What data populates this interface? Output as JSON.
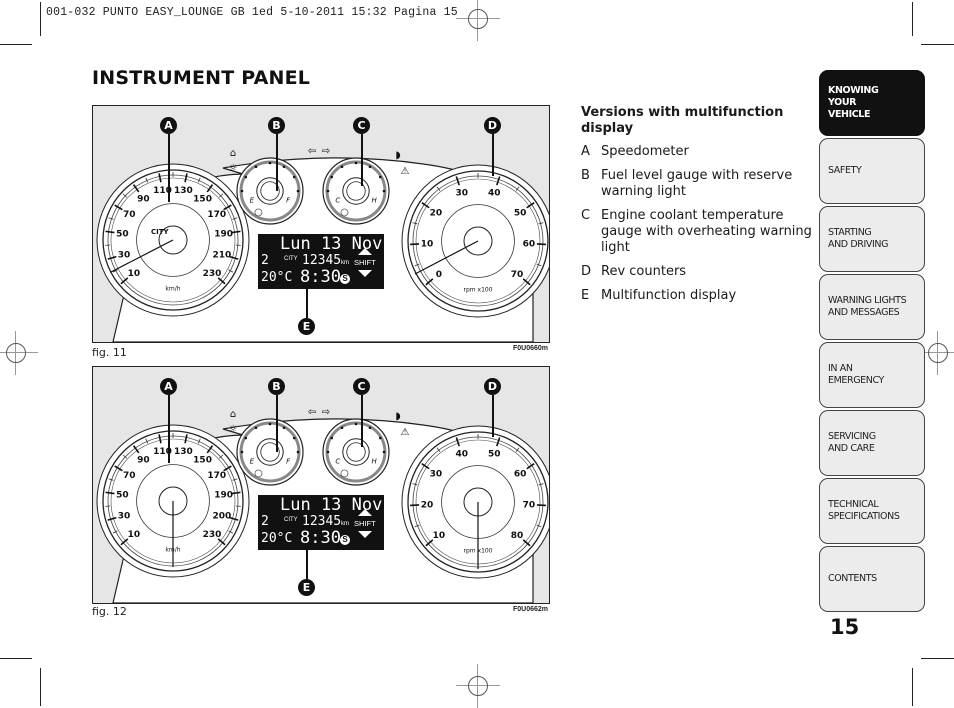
{
  "slug": "001-032 PUNTO EASY_LOUNGE GB 1ed  5-10-2011  15:32  Pagina 15",
  "page_title": "INSTRUMENT PANEL",
  "figures": [
    {
      "caption": "fig. 11",
      "code": "F0U0660m",
      "callouts": [
        "A",
        "B",
        "C",
        "D",
        "E"
      ],
      "speedo": {
        "ticks": [
          "10",
          "30",
          "50",
          "70",
          "90",
          "110",
          "130",
          "150",
          "170",
          "190",
          "210",
          "230"
        ],
        "unit": "km/h",
        "city": "CITY"
      },
      "fuel": {
        "empty": "E",
        "full": "F"
      },
      "temp": {
        "cold": "C",
        "hot": "H"
      },
      "rev": {
        "ticks": [
          "0",
          "10",
          "20",
          "30",
          "40",
          "50",
          "60",
          "70"
        ],
        "unit": "rpm x100"
      },
      "display": {
        "line1": "Lun 13 Nov",
        "gear": "2",
        "city": "CITY",
        "odometer": "12345",
        "odo_unit": "km",
        "temp": "20°C",
        "time": "8:30",
        "s_badge": "S",
        "shift": "SHIFT"
      }
    },
    {
      "caption": "fig. 12",
      "code": "F0U0662m",
      "callouts": [
        "A",
        "B",
        "C",
        "D",
        "E"
      ],
      "speedo": {
        "ticks": [
          "10",
          "30",
          "50",
          "70",
          "90",
          "110",
          "130",
          "150",
          "170",
          "190",
          "200",
          "230"
        ],
        "unit": "km/h"
      },
      "fuel": {
        "empty": "E",
        "full": "F"
      },
      "temp": {
        "cold": "C",
        "hot": "H"
      },
      "rev": {
        "ticks": [
          "10",
          "20",
          "30",
          "40",
          "50",
          "60",
          "70",
          "80"
        ],
        "unit": "rpm x100"
      },
      "display": {
        "line1": "Lun 13 Nov",
        "gear": "2",
        "city": "CITY",
        "odometer": "12345",
        "odo_unit": "km",
        "temp": "20°C",
        "time": "8:30",
        "s_badge": "S",
        "shift": "SHIFT"
      }
    }
  ],
  "legend": {
    "heading": "Versions with multifunction display",
    "items": [
      {
        "letter": "A",
        "text": "Speedometer"
      },
      {
        "letter": "B",
        "text": "Fuel level gauge with reserve warning light"
      },
      {
        "letter": "C",
        "text": "Engine coolant temperature gauge with overheating warning light"
      },
      {
        "letter": "D",
        "text": "Rev counters"
      },
      {
        "letter": "E",
        "text": "Multifunction display"
      }
    ]
  },
  "tabs": [
    {
      "line1": "KNOWING",
      "line2": "YOUR",
      "line3": "VEHICLE",
      "active": true
    },
    {
      "line1": "SAFETY",
      "line2": "",
      "line3": ""
    },
    {
      "line1": "STARTING",
      "line2": "AND DRIVING",
      "line3": ""
    },
    {
      "line1": "WARNING LIGHTS",
      "line2": "AND MESSAGES",
      "line3": ""
    },
    {
      "line1": "IN AN",
      "line2": "EMERGENCY",
      "line3": ""
    },
    {
      "line1": "SERVICING",
      "line2": "AND CARE",
      "line3": ""
    },
    {
      "line1": "TECHNICAL",
      "line2": "SPECIFICATIONS",
      "line3": ""
    },
    {
      "line1": "CONTENTS",
      "line2": "",
      "line3": ""
    }
  ],
  "page_number": "15"
}
